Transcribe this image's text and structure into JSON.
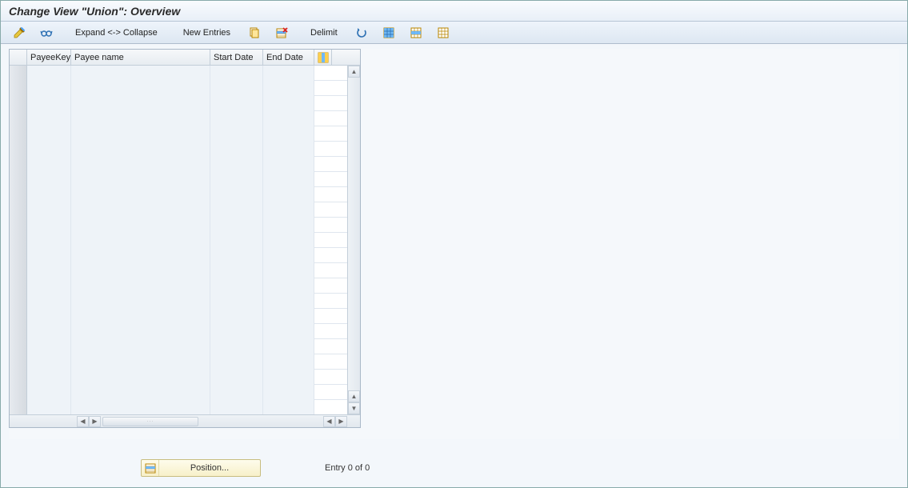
{
  "title": "Change View \"Union\": Overview",
  "toolbar": {
    "expand_collapse": "Expand <-> Collapse",
    "new_entries": "New Entries",
    "delimit": "Delimit"
  },
  "table": {
    "columns": {
      "payeekey": "PayeeKey",
      "payeename": "Payee name",
      "startdate": "Start Date",
      "enddate": "End Date"
    },
    "row_count": 23
  },
  "footer": {
    "position": "Position...",
    "entry": "Entry 0 of 0"
  },
  "icons": {
    "change": "change-pencil-icon",
    "otherview": "glasses-icon",
    "copy": "copy-icon",
    "delete": "delete-row-icon",
    "undo": "undo-arrow-icon",
    "selectall": "select-all-icon",
    "selectblock": "select-block-icon",
    "deselect": "deselect-all-icon",
    "config": "table-settings-icon",
    "position": "position-icon"
  }
}
